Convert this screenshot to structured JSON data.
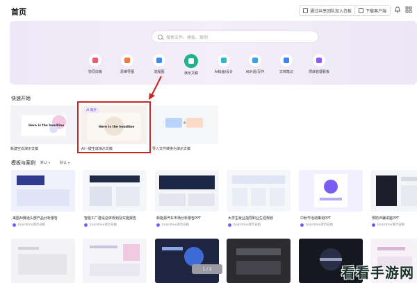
{
  "header": {
    "title": "首页",
    "join_team_label": "通过共享团队加入白板",
    "download_client_label": "下载客户端"
  },
  "hero": {
    "search_placeholder": "搜索文件、模板、案例",
    "tools": [
      {
        "label": "协同白板",
        "icon": "whiteboard-icon",
        "color": "#e85d75"
      },
      {
        "label": "思维导图",
        "icon": "mindmap-icon",
        "color": "#f07d3c"
      },
      {
        "label": "流程图",
        "icon": "flowchart-icon",
        "color": "#3d8bf0"
      },
      {
        "label": "演示文稿",
        "icon": "presentation-icon",
        "color": "#ffffff"
      },
      {
        "label": "AI绘画/设计",
        "icon": "ai-design-icon",
        "color": "#2fb5c9"
      },
      {
        "label": "AI对话/写作",
        "icon": "ai-writing-icon",
        "color": "#3aa0f0"
      },
      {
        "label": "文档笔记",
        "icon": "document-icon",
        "color": "#3b82f6"
      },
      {
        "label": "项目管理看板",
        "icon": "kanban-icon",
        "color": "#8b5cf6"
      }
    ]
  },
  "quick_start": {
    "title": "快速开始",
    "cards": [
      {
        "label": "新建空白演示文稿",
        "thumb_text": "Here is the headline"
      },
      {
        "label": "AI一键生成演示文稿",
        "badge": "AI 帮手",
        "thumb_text": "Here is the headline"
      },
      {
        "label": "导入文件转换为演示文稿"
      }
    ]
  },
  "templates": {
    "title": "模板与案例",
    "filter1": "默认",
    "filter2": "默认",
    "items": [
      {
        "title": "美国AI赛道头部产品分析报告",
        "source": "boardmix演示白板"
      },
      {
        "title": "智能工厂建设总体规划及实施报告",
        "source": "boardmix演示白板"
      },
      {
        "title": "新能源汽车市场分析报告PPT",
        "source": "boardmix演示白板"
      },
      {
        "title": "大学生就业指导职业生涯规划",
        "source": "boardmix演示白板"
      },
      {
        "title": "中秋节活动策划PPT",
        "source": "boardmix演示白板"
      },
      {
        "title": "预防诈骗讲座PPT",
        "source": "boardmix演示白板"
      }
    ]
  },
  "pager": "1 / 2",
  "watermark": "看看手游网"
}
